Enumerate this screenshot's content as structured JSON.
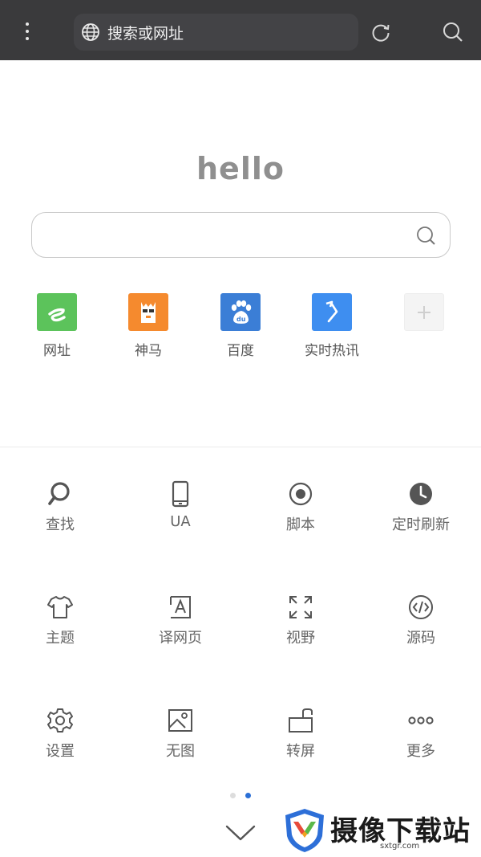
{
  "topbar": {
    "address_placeholder": "搜索或网址"
  },
  "home": {
    "logo_text": "hello"
  },
  "shortcuts": [
    {
      "label": "网址",
      "color": "#5cc35b",
      "icon": "e-icon"
    },
    {
      "label": "神马",
      "color": "#f58a2e",
      "icon": "alpaca-icon"
    },
    {
      "label": "百度",
      "color": "#3b7ed6",
      "icon": "baidu-paw-icon"
    },
    {
      "label": "实时热讯",
      "color": "#3e8ef0",
      "icon": "arrow-icon"
    },
    {
      "label": "",
      "color": "#f4f4f4",
      "icon": "plus-icon"
    }
  ],
  "menu": [
    {
      "label": "查找",
      "icon": "search-icon"
    },
    {
      "label": "UA",
      "icon": "phone-icon"
    },
    {
      "label": "脚本",
      "icon": "record-icon"
    },
    {
      "label": "定时刷新",
      "icon": "clock-icon"
    },
    {
      "label": "主题",
      "icon": "tshirt-icon"
    },
    {
      "label": "译网页",
      "icon": "translate-icon"
    },
    {
      "label": "视野",
      "icon": "expand-icon"
    },
    {
      "label": "源码",
      "icon": "code-icon"
    },
    {
      "label": "设置",
      "icon": "gear-icon"
    },
    {
      "label": "无图",
      "icon": "image-icon"
    },
    {
      "label": "转屏",
      "icon": "rotate-screen-icon"
    },
    {
      "label": "更多",
      "icon": "more-icon"
    }
  ],
  "pager": {
    "active_color": "#2b6fd6",
    "inactive_color": "#dddddd"
  },
  "watermark": {
    "title": "摄像下载站",
    "url": "sxtgr.com"
  }
}
